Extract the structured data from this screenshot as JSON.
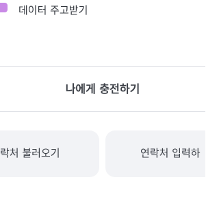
{
  "data_share": {
    "icon": "data-gift-icon",
    "label": "데이터 주고받기"
  },
  "charge": {
    "label": "나에게 충전하기"
  },
  "contact_actions": {
    "load_label": "연락처 불러오기",
    "load_visible_text": "락처 불러오기",
    "input_label": "연락처 입력하기",
    "input_visible_text": "연락처 입력하"
  },
  "colors": {
    "icon": "#c98ae6",
    "button_bg": "#f2f3f6",
    "divider": "#dfe1e6",
    "text": "#30343b"
  }
}
